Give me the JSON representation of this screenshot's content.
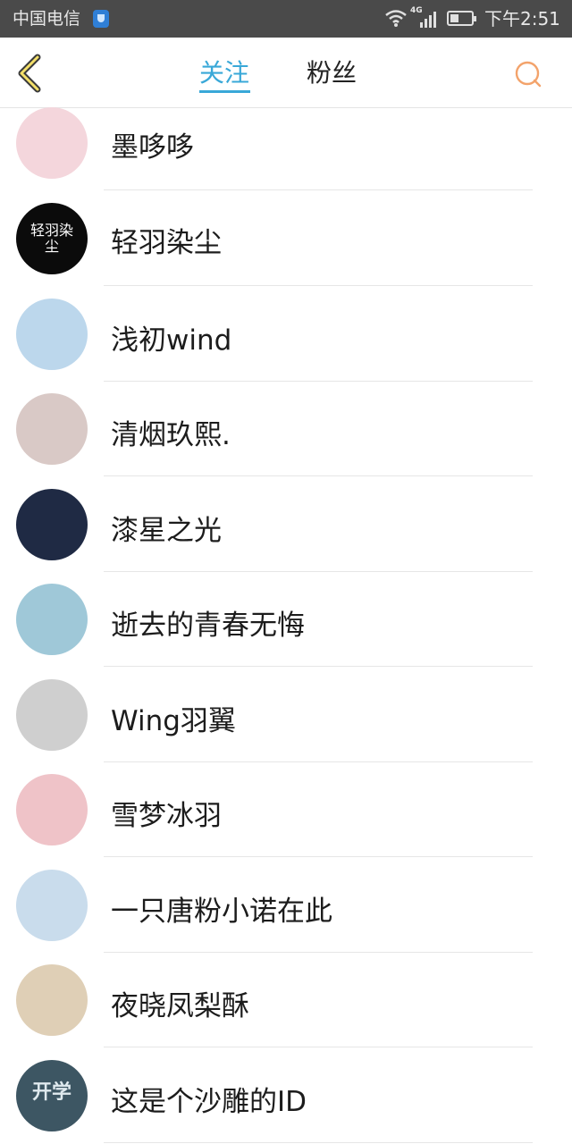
{
  "status_bar": {
    "carrier": "中国电信",
    "network": "4G",
    "time": "下午2:51"
  },
  "nav": {
    "tabs": [
      {
        "label": "关注",
        "active": true
      },
      {
        "label": "粉丝",
        "active": false
      }
    ],
    "accent_color": "#39a8d8",
    "back_icon": "chevron-left-icon",
    "search_icon": "search-icon"
  },
  "users": [
    {
      "name": "墨哆哆",
      "avatar_color": "#f4d6dc"
    },
    {
      "name": "轻羽染尘",
      "avatar_color": "#0b0b0b",
      "avatar_text": "轻羽染尘"
    },
    {
      "name": "浅初wind",
      "avatar_color": "#bcd7ec"
    },
    {
      "name": "清烟玖熙.",
      "avatar_color": "#d9c9c6"
    },
    {
      "name": "漆星之光",
      "avatar_color": "#1f2a44"
    },
    {
      "name": "逝去的青春无悔",
      "avatar_color": "#9fc8d8"
    },
    {
      "name": "Wing羽翼",
      "avatar_color": "#cfcfcf"
    },
    {
      "name": "雪梦冰羽",
      "avatar_color": "#efc3c8"
    },
    {
      "name": "一只唐粉小诺在此",
      "avatar_color": "#c9dcec"
    },
    {
      "name": "夜晓凤梨酥",
      "avatar_color": "#dfcfb6"
    },
    {
      "name": "这是个沙雕的ID",
      "avatar_color": "#3d5663",
      "avatar_text": "开学"
    }
  ]
}
